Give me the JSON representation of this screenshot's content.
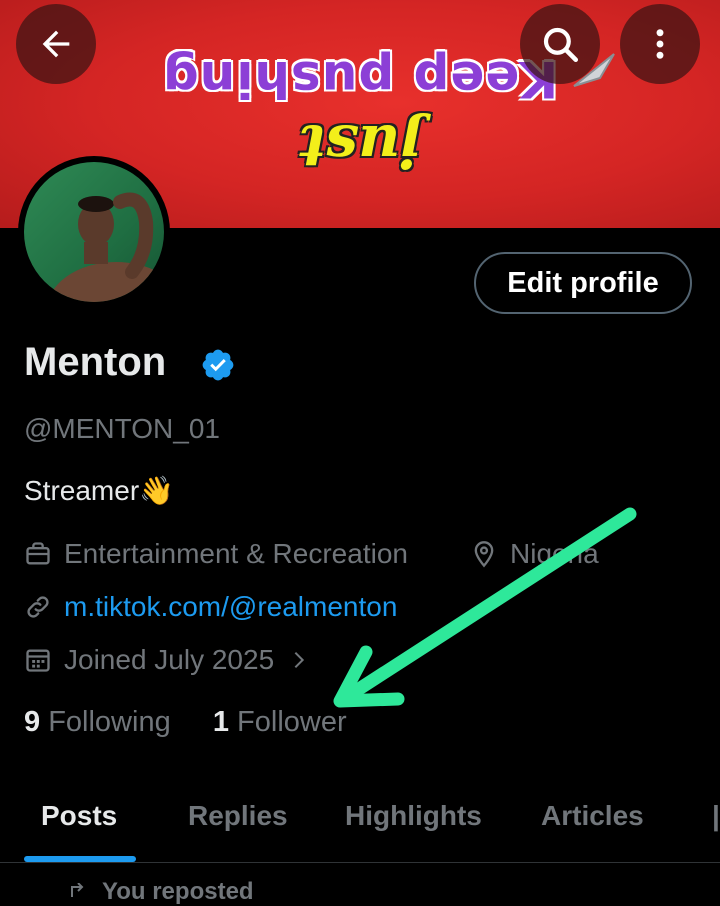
{
  "banner": {
    "line1": "Keep pushing",
    "line2": "just"
  },
  "header": {
    "back_icon": "arrow-left-icon",
    "search_icon": "search-icon",
    "more_icon": "more-vertical-icon"
  },
  "profile": {
    "name": "Menton",
    "handle": "@MENTON_01",
    "bio": "Streamer👋",
    "category": "Entertainment & Recreation",
    "location": "Nigeria",
    "website": "m.tiktok.com/@realmenton",
    "joined": "Joined July 2025",
    "edit_label": "Edit profile",
    "verified_color": "#1d9bf0"
  },
  "stats": {
    "following_count": "9",
    "following_label": "Following",
    "followers_count": "1",
    "followers_label": "Follower"
  },
  "tabs": [
    "Posts",
    "Replies",
    "Highlights",
    "Articles"
  ],
  "feed": {
    "repost_label": "You reposted"
  },
  "annotation": {
    "arrow_color": "#2ee89a"
  }
}
